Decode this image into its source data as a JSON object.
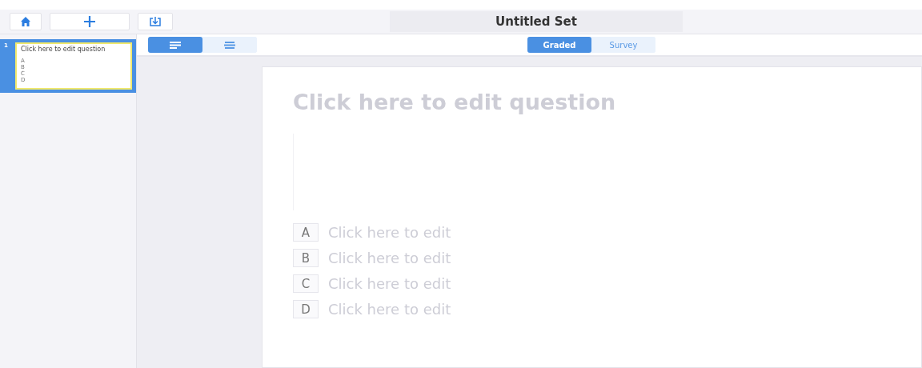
{
  "toolbar": {
    "buttons": [
      {
        "kind": "home"
      },
      {
        "kind": "add"
      },
      {
        "kind": "export"
      }
    ],
    "title": "Untitled Set"
  },
  "slides": [
    {
      "number": "1",
      "selected": true,
      "question": "Click here to edit question",
      "options": [
        "A",
        "B",
        "C",
        "D"
      ]
    }
  ],
  "align_buttons": [
    {
      "kind": "left",
      "selected": true
    },
    {
      "kind": "center",
      "selected": false
    }
  ],
  "mode_tabs": [
    {
      "label": "Graded",
      "selected": true
    },
    {
      "label": "Survey",
      "selected": false
    }
  ],
  "question": {
    "placeholder": "Click here to edit question"
  },
  "answers": [
    {
      "letter": "A",
      "placeholder": "Click here to edit"
    },
    {
      "letter": "B",
      "placeholder": "Click here to edit"
    },
    {
      "letter": "C",
      "placeholder": "Click here to edit"
    },
    {
      "letter": "D",
      "placeholder": "Click here to edit"
    }
  ]
}
